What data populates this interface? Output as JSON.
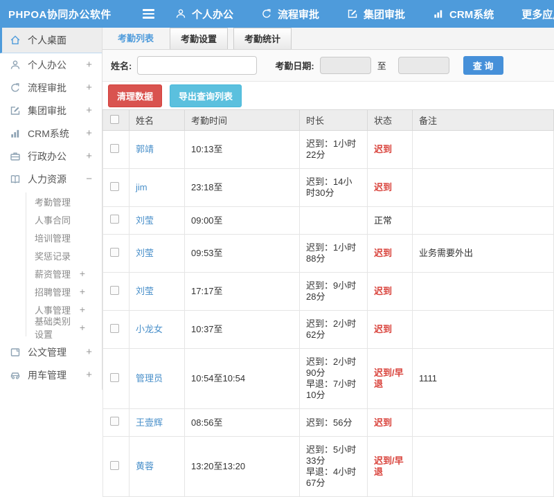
{
  "header": {
    "logo": "PHPOA协同办公软件",
    "nav": [
      {
        "label": "个人办公",
        "icon": "user-icon"
      },
      {
        "label": "流程审批",
        "icon": "workflow-icon"
      },
      {
        "label": "集团审批",
        "icon": "edit-icon"
      },
      {
        "label": "CRM系统",
        "icon": "chart-icon"
      },
      {
        "label": "更多应用",
        "icon": "caret-down-icon",
        "caret": true
      }
    ]
  },
  "sidebar": {
    "items": [
      {
        "label": "个人桌面",
        "icon": "home-icon",
        "active": true
      },
      {
        "label": "个人办公",
        "icon": "user-icon",
        "expand": "+"
      },
      {
        "label": "流程审批",
        "icon": "workflow-icon",
        "expand": "+"
      },
      {
        "label": "集团审批",
        "icon": "edit-icon",
        "expand": "+"
      },
      {
        "label": "CRM系统",
        "icon": "chart-icon",
        "expand": "+"
      },
      {
        "label": "行政办公",
        "icon": "briefcase-icon",
        "expand": "+"
      },
      {
        "label": "人力资源",
        "icon": "book-icon",
        "expand": "−",
        "children": [
          {
            "label": "考勤管理"
          },
          {
            "label": "人事合同"
          },
          {
            "label": "培训管理"
          },
          {
            "label": "奖惩记录"
          },
          {
            "label": "薪资管理",
            "expand": "+"
          },
          {
            "label": "招聘管理",
            "expand": "+"
          },
          {
            "label": "人事管理",
            "expand": "+"
          },
          {
            "label": "基础类别设置",
            "expand": "+"
          }
        ]
      },
      {
        "label": "公文管理",
        "icon": "document-icon",
        "expand": "+"
      },
      {
        "label": "用车管理",
        "icon": "car-icon",
        "expand": "+"
      }
    ]
  },
  "tabs": [
    {
      "label": "考勤列表",
      "active": true
    },
    {
      "label": "考勤设置",
      "active": false
    },
    {
      "label": "考勤统计",
      "active": false
    }
  ],
  "filter": {
    "name_label": "姓名:",
    "name_value": "",
    "date_label": "考勤日期:",
    "date_from": "",
    "to_label": "至",
    "date_to": "",
    "search_button": "查 询"
  },
  "toolbar": {
    "clean_button": "清理数据",
    "export_button": "导出查询列表"
  },
  "table": {
    "columns": [
      "姓名",
      "考勤时间",
      "时长",
      "状态",
      "备注"
    ],
    "rows": [
      {
        "name": "郭靖",
        "time": "10:13至",
        "duration": "迟到：1小时22分",
        "status": "迟到",
        "status_red": true,
        "note": ""
      },
      {
        "name": "jim",
        "time": "23:18至",
        "duration": "迟到：14小时30分",
        "status": "迟到",
        "status_red": true,
        "note": ""
      },
      {
        "name": "刘莹",
        "time": "09:00至",
        "duration": "",
        "status": "正常",
        "status_red": false,
        "note": ""
      },
      {
        "name": "刘莹",
        "time": "09:53至",
        "duration": "迟到：1小时88分",
        "status": "迟到",
        "status_red": true,
        "note": "业务需要外出"
      },
      {
        "name": "刘莹",
        "time": "17:17至",
        "duration": "迟到：9小时28分",
        "status": "迟到",
        "status_red": true,
        "note": ""
      },
      {
        "name": "小龙女",
        "time": "10:37至",
        "duration": "迟到：2小时62分",
        "status": "迟到",
        "status_red": true,
        "note": ""
      },
      {
        "name": "管理员",
        "time": "10:54至10:54",
        "duration": "迟到：2小时90分\n早退：7小时10分",
        "status": "迟到/早退",
        "status_red": true,
        "note": "1111"
      },
      {
        "name": "王壹辉",
        "time": "08:56至",
        "duration": "迟到：56分",
        "status": "迟到",
        "status_red": true,
        "note": ""
      },
      {
        "name": "黄蓉",
        "time": "13:20至13:20",
        "duration": "迟到：5小时33分\n早退：4小时67分",
        "status": "迟到/早退",
        "status_red": true,
        "note": ""
      }
    ]
  },
  "colors": {
    "header_blue": "#4e9bdb",
    "link_blue": "#4a90ca",
    "status_red": "#d9433c",
    "button_red": "#d9534f",
    "button_cyan": "#5bc0de",
    "search_blue": "#4690d9"
  }
}
